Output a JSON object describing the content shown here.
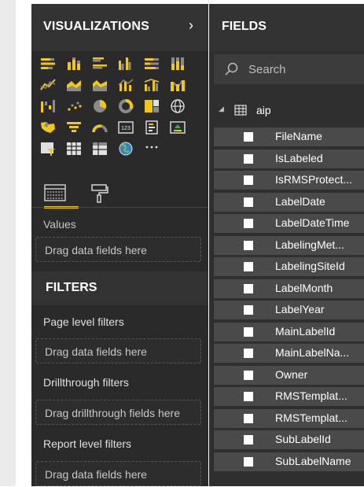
{
  "visualizations": {
    "title": "VISUALIZATIONS",
    "chevron": "›",
    "values_label": "Values",
    "values_drop": "Drag data fields here"
  },
  "filters": {
    "title": "FILTERS",
    "page_label": "Page level filters",
    "page_drop": "Drag data fields here",
    "drill_label": "Drillthrough filters",
    "drill_drop": "Drag drillthrough fields here",
    "report_label": "Report level filters",
    "report_drop": "Drag data fields here"
  },
  "fields_pane": {
    "title": "FIELDS",
    "search_placeholder": "Search",
    "table_name": "aip",
    "items": [
      "FileName",
      "IsLabeled",
      "IsRMSProtect...",
      "LabelDate",
      "LabelDateTime",
      "LabelingMet...",
      "LabelingSiteId",
      "LabelMonth",
      "LabelYear",
      "MainLabelId",
      "MainLabelNa...",
      "Owner",
      "RMSTemplat...",
      "RMSTemplat...",
      "SubLabelId",
      "SubLabelName"
    ]
  },
  "colors": {
    "accent": "#f2c811",
    "pane_bg": "#2a2a2a",
    "header_bg": "#333333",
    "field_row_bg": "#4a4a4a"
  }
}
